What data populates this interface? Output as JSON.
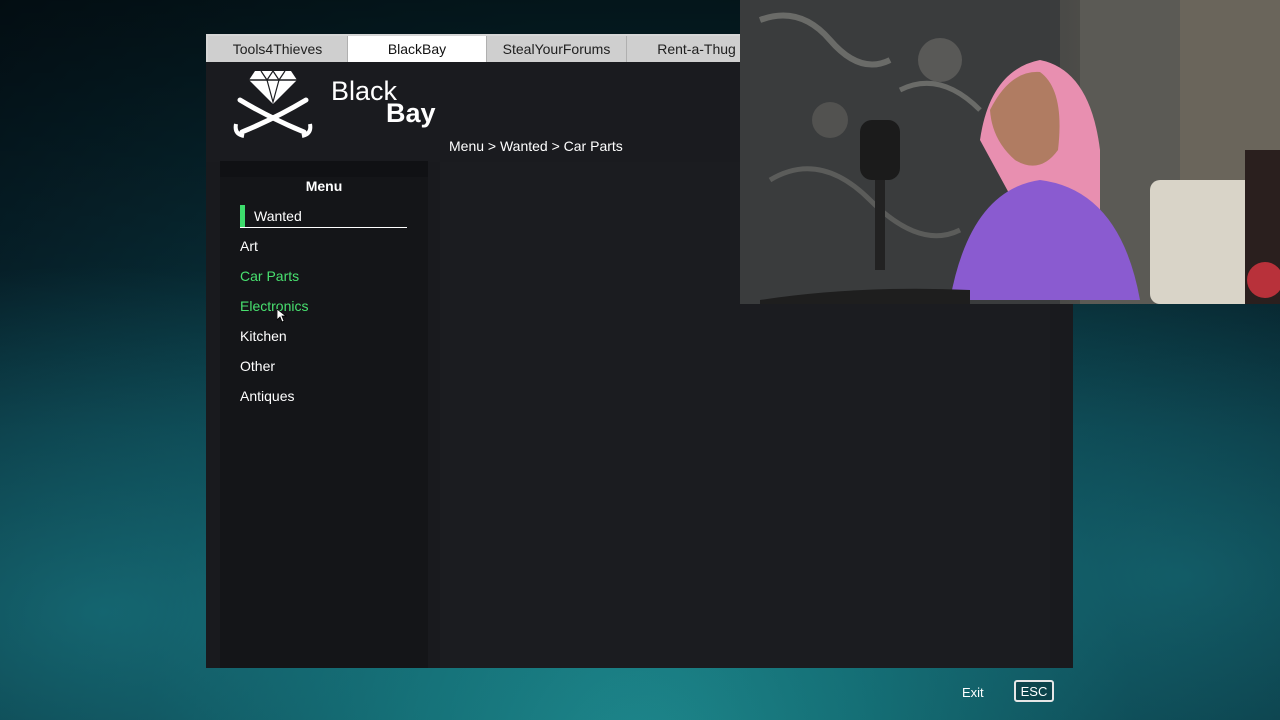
{
  "tabs": [
    {
      "label": "Tools4Thieves",
      "active": false
    },
    {
      "label": "BlackBay",
      "active": true
    },
    {
      "label": "StealYourForums",
      "active": false
    },
    {
      "label": "Rent-a-Thug",
      "active": false
    }
  ],
  "logo": {
    "word1": "Black",
    "word2": "Bay",
    "icon": "diamond-crossed-swords-icon"
  },
  "breadcrumb": "Menu > Wanted > Car Parts",
  "sidebar": {
    "title": "Menu",
    "active_item": "Wanted",
    "items": [
      {
        "label": "Art",
        "highlighted": false
      },
      {
        "label": "Car Parts",
        "highlighted": true
      },
      {
        "label": "Electronics",
        "highlighted": true
      },
      {
        "label": "Kitchen",
        "highlighted": false
      },
      {
        "label": "Other",
        "highlighted": false
      },
      {
        "label": "Antiques",
        "highlighted": false
      }
    ]
  },
  "footer": {
    "exit_label": "Exit",
    "key_label": "ESC"
  },
  "colors": {
    "accent_green": "#48e06f",
    "active_bar": "#3ddc6c",
    "panel_bg": "#191a1e"
  }
}
